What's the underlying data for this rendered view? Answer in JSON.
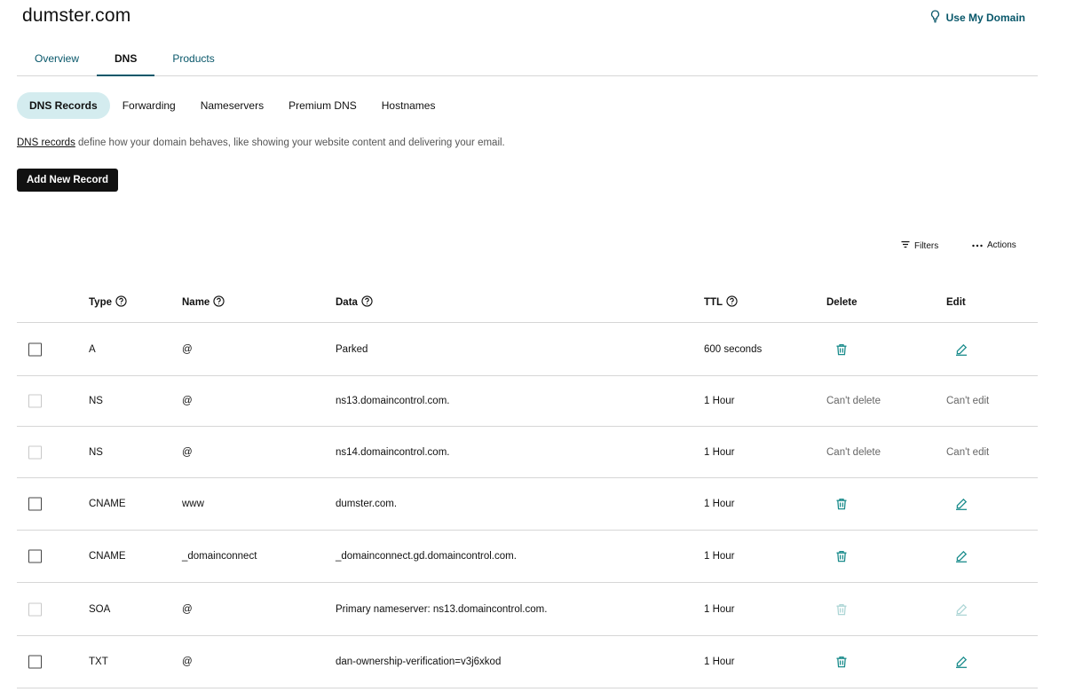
{
  "header": {
    "domain": "dumster.com",
    "use_domain_label": "Use My Domain"
  },
  "main_tabs": [
    {
      "label": "Overview",
      "active": false
    },
    {
      "label": "DNS",
      "active": true
    },
    {
      "label": "Products",
      "active": false
    }
  ],
  "sub_tabs": [
    {
      "label": "DNS Records",
      "active": true
    },
    {
      "label": "Forwarding",
      "active": false
    },
    {
      "label": "Nameservers",
      "active": false
    },
    {
      "label": "Premium DNS",
      "active": false
    },
    {
      "label": "Hostnames",
      "active": false
    }
  ],
  "description": {
    "link": "DNS records",
    "text": " define how your domain behaves, like showing your website content and delivering your email."
  },
  "add_button": "Add New Record",
  "tools": {
    "filters": "Filters",
    "actions": "Actions"
  },
  "columns": {
    "type": "Type",
    "name": "Name",
    "data": "Data",
    "ttl": "TTL",
    "delete": "Delete",
    "edit": "Edit"
  },
  "records": [
    {
      "type": "A",
      "name": "@",
      "data": "Parked",
      "ttl": "600 seconds",
      "delete": "",
      "edit": ""
    },
    {
      "type": "NS",
      "name": "@",
      "data": "ns13.domaincontrol.com.",
      "ttl": "1 Hour",
      "delete": "Can't delete",
      "edit": "Can't edit"
    },
    {
      "type": "NS",
      "name": "@",
      "data": "ns14.domaincontrol.com.",
      "ttl": "1 Hour",
      "delete": "Can't delete",
      "edit": "Can't edit"
    },
    {
      "type": "CNAME",
      "name": "www",
      "data": "dumster.com.",
      "ttl": "1 Hour",
      "delete": "",
      "edit": ""
    },
    {
      "type": "CNAME",
      "name": "_domainconnect",
      "data": "_domainconnect.gd.domaincontrol.com.",
      "ttl": "1 Hour",
      "delete": "",
      "edit": ""
    },
    {
      "type": "SOA",
      "name": "@",
      "data": "Primary nameserver: ns13.domaincontrol.com.",
      "ttl": "1 Hour",
      "delete": "",
      "edit": ""
    },
    {
      "type": "TXT",
      "name": "@",
      "data": "dan-ownership-verification=v3j6xkod",
      "ttl": "1 Hour",
      "delete": "",
      "edit": ""
    }
  ],
  "colors": {
    "accent": "#08576a",
    "icon": "#1b8c8c",
    "active_subtab_bg": "#d4ecef",
    "border": "#d6d6d6"
  },
  "icons": {
    "use_domain": "lightbulb-icon",
    "filters": "filter-lines-icon",
    "actions": "more-dots-icon",
    "help": "question-circle-icon",
    "delete": "trash-icon",
    "edit": "pencil-icon"
  }
}
